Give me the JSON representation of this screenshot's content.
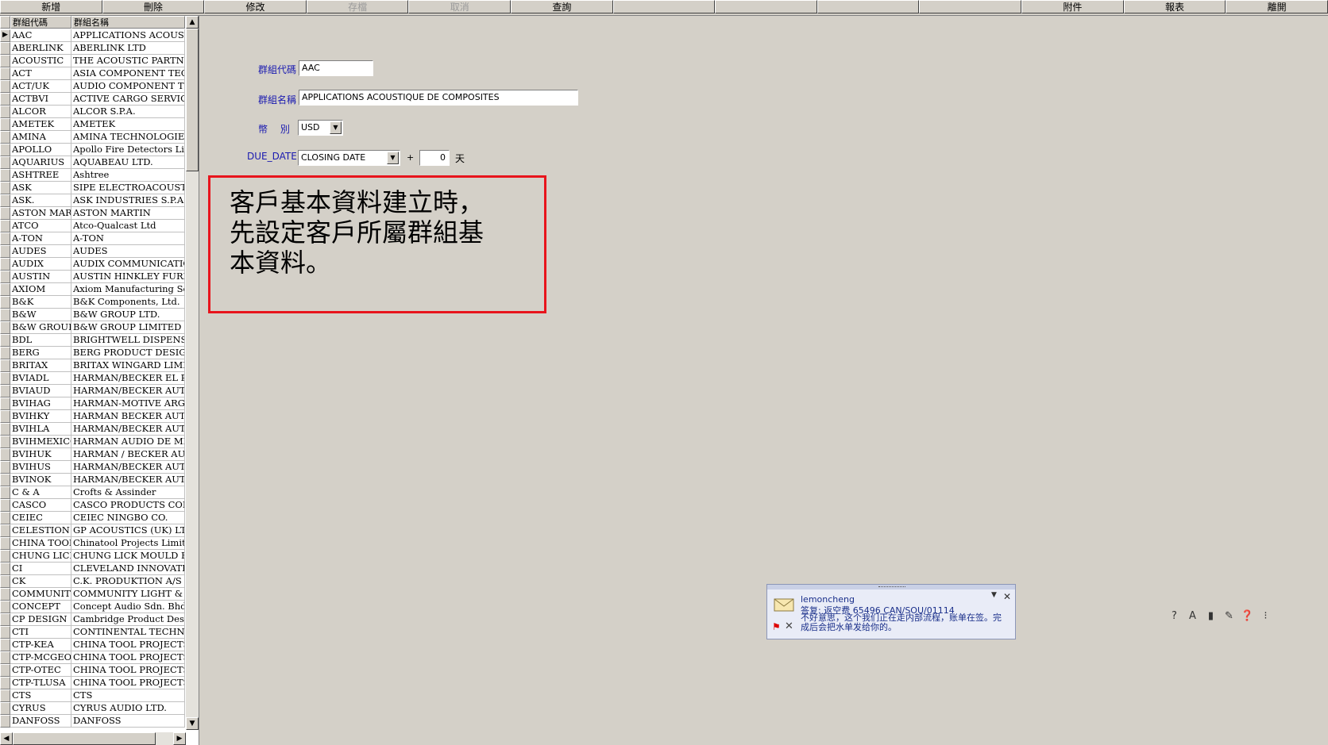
{
  "toolbar": {
    "buttons": [
      {
        "label": "新增",
        "enabled": true
      },
      {
        "label": "刪除",
        "enabled": true
      },
      {
        "label": "修改",
        "enabled": true
      },
      {
        "label": "存檔",
        "enabled": false
      },
      {
        "label": "取消",
        "enabled": false
      },
      {
        "label": "查詢",
        "enabled": true
      },
      {
        "label": "",
        "enabled": true
      },
      {
        "label": "",
        "enabled": true
      },
      {
        "label": "",
        "enabled": true
      },
      {
        "label": "",
        "enabled": true
      },
      {
        "label": "附件",
        "enabled": true
      },
      {
        "label": "報表",
        "enabled": true
      },
      {
        "label": "離開",
        "enabled": true
      }
    ]
  },
  "grid": {
    "columns": [
      "群組代碼",
      "群組名稱"
    ],
    "rows": [
      [
        "AAC",
        "APPLICATIONS ACOUSTIQ"
      ],
      [
        "ABERLINK",
        "ABERLINK LTD"
      ],
      [
        "ACOUSTIC",
        "THE ACOUSTIC PARTNERS"
      ],
      [
        "ACT",
        "ASIA COMPONENT TECHN"
      ],
      [
        "ACT/UK",
        "AUDIO COMPONENT TECH"
      ],
      [
        "ACTBVI",
        "ACTIVE CARGO SERVICES"
      ],
      [
        "ALCOR",
        "ALCOR S.P.A."
      ],
      [
        "AMETEK",
        "AMETEK"
      ],
      [
        "AMINA",
        "AMINA TECHNOLOGIES LT"
      ],
      [
        "APOLLO",
        "Apollo Fire Detectors Limited"
      ],
      [
        "AQUARIUS",
        "AQUABEAU LTD."
      ],
      [
        "ASHTREE",
        "Ashtree"
      ],
      [
        "ASK",
        "SIPE ELECTROACOUSTICS"
      ],
      [
        "ASK.",
        "ASK INDUSTRIES S.P.A."
      ],
      [
        "ASTON MART",
        "ASTON MARTIN"
      ],
      [
        "ATCO",
        "Atco-Qualcast Ltd"
      ],
      [
        "A-TON",
        "A-TON"
      ],
      [
        "AUDES",
        "AUDES"
      ],
      [
        "AUDIX",
        "AUDIX COMMUNICATIONS"
      ],
      [
        "AUSTIN",
        "AUSTIN HINKLEY FURNIT"
      ],
      [
        "AXIOM",
        "Axiom Manufacturing Service"
      ],
      [
        "B&K",
        "B&K Components, Ltd."
      ],
      [
        "B&W",
        "B&W GROUP LTD."
      ],
      [
        "B&W GROUP",
        "B&W GROUP LIMITED (RC"
      ],
      [
        "BDL",
        "BRIGHTWELL DISPENSERS"
      ],
      [
        "BERG",
        "BERG PRODUCT DESIGN L"
      ],
      [
        "BRITAX",
        "BRITAX WINGARD LIMITE"
      ],
      [
        "BVIADL",
        "HARMAN/BECKER EL PAS"
      ],
      [
        "BVIAUD",
        "HARMAN/BECKER AUTOM"
      ],
      [
        "BVIHAG",
        "HARMAN-MOTIVE ARGEN"
      ],
      [
        "BVIHKY",
        "HARMAN BECKER AUTOM"
      ],
      [
        "BVIHLA",
        "HARMAN/BECKER AUTOM"
      ],
      [
        "BVIHMEXICO",
        "HARMAN AUDIO DE MEXI"
      ],
      [
        "BVIHUK",
        "HARMAN / BECKER AUTO"
      ],
      [
        "BVIHUS",
        "HARMAN/BECKER AUTOM"
      ],
      [
        "BVINOK",
        "HARMAN/BECKER AUTO."
      ],
      [
        "C & A",
        "Crofts & Assinder"
      ],
      [
        "CASCO",
        "CASCO PRODUCTS CORPO"
      ],
      [
        "CEIEC",
        "CEIEC NINGBO CO."
      ],
      [
        "CELESTION",
        "GP ACOUSTICS (UK)  LTD"
      ],
      [
        "CHINA TOOL",
        "Chinatool Projects Limited"
      ],
      [
        "CHUNG LICK",
        "CHUNG LICK MOULD FAC"
      ],
      [
        "CI",
        "CLEVELAND INNOVATION"
      ],
      [
        "CK",
        "C.K. PRODUKTION A/S"
      ],
      [
        "COMMUNITY",
        "COMMUNITY LIGHT & SOU"
      ],
      [
        "CONCEPT",
        "Concept Audio Sdn. Bhd."
      ],
      [
        "CP DESIGN",
        "Cambridge Product Design Li"
      ],
      [
        "CTI",
        "CONTINENTAL TECHNOLO"
      ],
      [
        "CTP-KEA",
        "CHINA TOOL PROJECTS UI"
      ],
      [
        "CTP-MCGEOC",
        "CHINA TOOL PROJECTS UI"
      ],
      [
        "CTP-OTEC",
        "CHINA TOOL PROJECTS UK"
      ],
      [
        "CTP-TLUSA",
        "CHINA TOOL PROJECTS UI"
      ],
      [
        "CTS",
        "CTS"
      ],
      [
        "CYRUS",
        "CYRUS AUDIO LTD."
      ],
      [
        "DANFOSS",
        "DANFOSS"
      ]
    ]
  },
  "form": {
    "group_code_label": "群組代碼",
    "group_code_value": "AAC",
    "group_name_label": "群組名稱",
    "group_name_value": "APPLICATIONS ACOUSTIQUE  DE COMPOSITES",
    "currency_label": "幣　 別",
    "currency_value": "USD",
    "due_date_label": "DUE_DATE",
    "due_date_value": "CLOSING DATE",
    "plus_sign": "+",
    "days_value": "0",
    "days_unit": "天"
  },
  "note": {
    "lines": [
      "客戶基本資料建立時，",
      "先設定客戶所屬群組基",
      "本資料。"
    ],
    "border_color": "#e8141c"
  },
  "popup": {
    "from": "lemoncheng",
    "subject": "答复: 返空费  65496  CAN/SOU/01114",
    "body": "不好意思，这个我们正在走内部流程，账单在签。完成后会把水单发给你的。"
  },
  "icons": {
    "popup": [
      "envelope-icon",
      "flag-icon",
      "delete-icon",
      "menu-arrow-icon",
      "close-icon"
    ],
    "tray": [
      "help-icon-1",
      "font-icon",
      "bar-icon",
      "pen-icon",
      "help-icon",
      "more-icon"
    ]
  }
}
